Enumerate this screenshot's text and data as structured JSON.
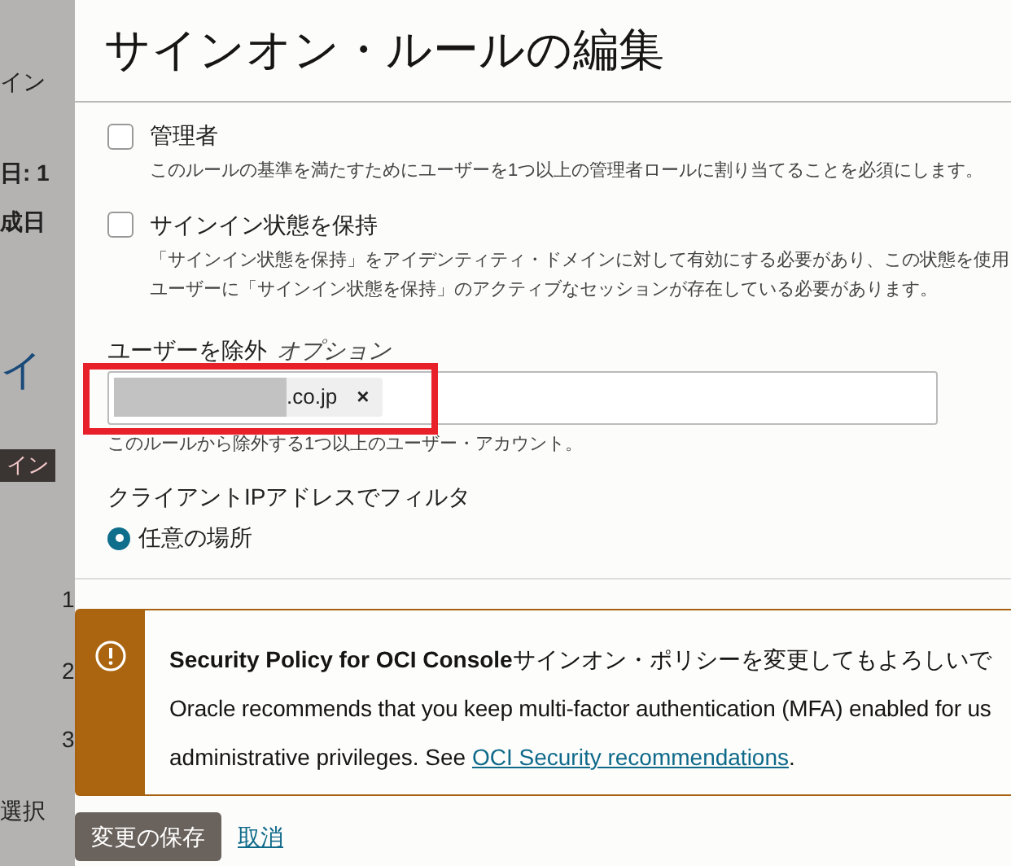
{
  "background_page": {
    "fragments": [
      {
        "text": "イン",
        "kind": "plain"
      },
      {
        "text": "日: 1",
        "kind": "bold"
      },
      {
        "text": "成日",
        "kind": "bold"
      },
      {
        "text": "イ",
        "kind": "heading"
      },
      {
        "text": "イン",
        "kind": "button"
      },
      {
        "text": "1",
        "kind": "cell"
      },
      {
        "text": "2",
        "kind": "cell"
      },
      {
        "text": "3",
        "kind": "cell"
      },
      {
        "text": "選択",
        "kind": "plain"
      }
    ]
  },
  "panel": {
    "title": "サインオン・ルールの編集"
  },
  "options": [
    {
      "kind": "checkbox",
      "label": "管理者",
      "checked": false,
      "description": [
        "このルールの基準を満たすためにユーザーを1つ以上の管理者ロールに割り当てることを必須にします。"
      ]
    },
    {
      "kind": "checkbox",
      "label": "サインイン状態を保持",
      "checked": false,
      "description": [
        "「サインイン状態を保持」をアイデンティティ・ドメインに対して有効にする必要があり、この状態を使用",
        "ユーザーに「サインイン状態を保持」のアクティブなセッションが存在している必要があります。"
      ]
    }
  ],
  "exclude_users": {
    "label": "ユーザーを除外",
    "optional": "オプション",
    "highlighted": true,
    "chips": [
      {
        "value": ".co.jp",
        "redacted": true,
        "remove": "×"
      }
    ],
    "help": "このルールから除外する1つ以上のユーザー・アカウント。"
  },
  "ip_filter": {
    "label": "クライアントIPアドレスでフィルタ",
    "choices": [
      {
        "label": "任意の場所",
        "selected": true
      }
    ]
  },
  "warning": {
    "title": "Security Policy for OCI Console",
    "title_rest": "サインオン・ポリシーを変更してもよろしいで",
    "line1": "Oracle recommends that you keep multi-factor authentication (MFA) enabled for us",
    "line2": "administrative privileges. See ",
    "link": "OCI Security recommendations",
    "line2_end": "."
  },
  "buttons": {
    "save": "変更の保存",
    "cancel": "取消"
  }
}
